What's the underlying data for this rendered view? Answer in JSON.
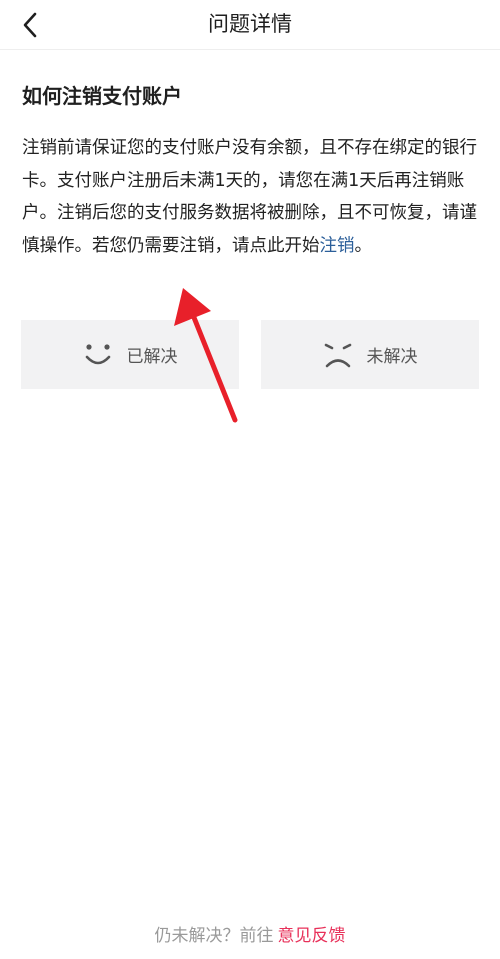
{
  "nav": {
    "title": "问题详情",
    "back_icon": "chevron-left-icon"
  },
  "article": {
    "title": "如何注销支付账户",
    "body": "注销前请保证您的支付账户没有余额，且不存在绑定的银行卡。支付账户注册后未满1天的，请您在满1天后再注销账户。注销后您的支付服务数据将被删除，且不可恢复，请谨慎操作。若您仍需要注销，请点此开始",
    "link_text": "注销",
    "body_end": "。"
  },
  "feedback": {
    "solved_label": "已解决",
    "solved_icon": "smile-icon",
    "unsolved_label": "未解决",
    "unsolved_icon": "frown-icon"
  },
  "footer": {
    "prompt": "仍未解决？前往",
    "link": "意见反馈"
  },
  "colors": {
    "link_blue": "#2c5f9a",
    "feedback_red": "#e8315a",
    "annotation_red": "#e8202a",
    "button_bg": "#f2f2f3"
  }
}
